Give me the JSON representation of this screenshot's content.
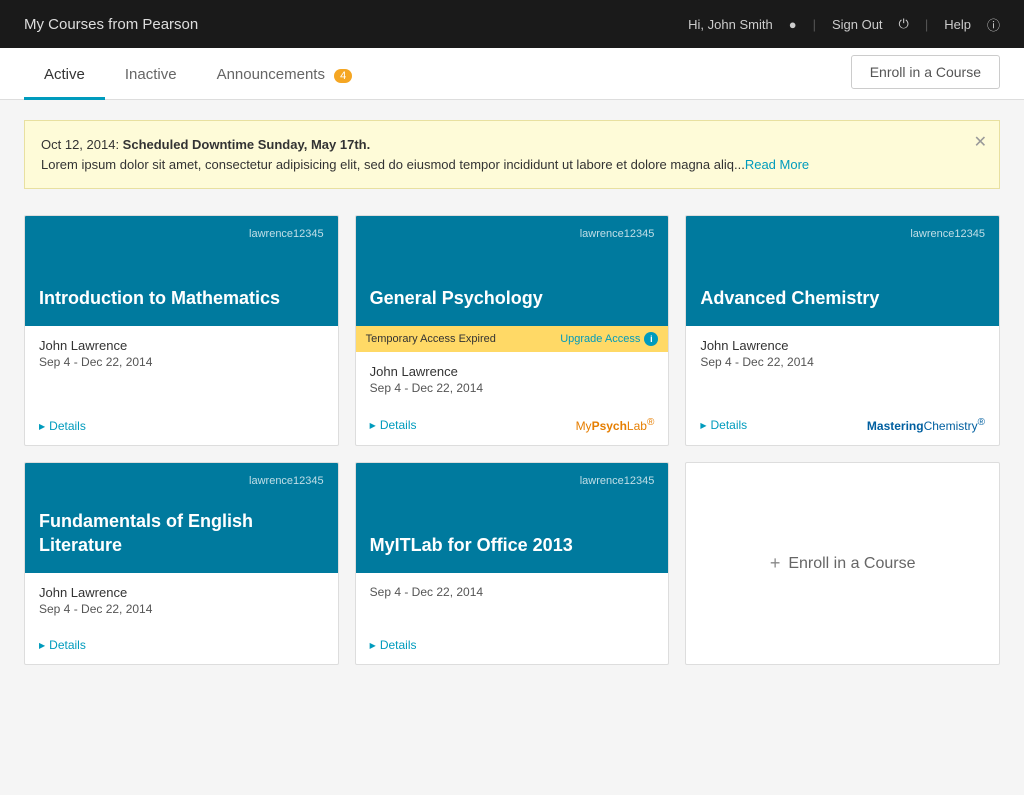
{
  "header": {
    "title": "My Courses from Pearson",
    "user": "Hi, John Smith",
    "signout": "Sign Out",
    "help": "Help"
  },
  "tabs": {
    "active_label": "Active",
    "inactive_label": "Inactive",
    "announcements_label": "Announcements",
    "announcements_badge": "4",
    "enroll_button": "Enroll in a Course"
  },
  "announcement": {
    "date": "Oct 12, 2014: ",
    "bold_text": "Scheduled Downtime Sunday, May 17th.",
    "body": "Lorem ipsum dolor sit amet, consectetur adipisicing elit, sed do eiusmod tempor incididunt ut labore et dolore magna aliq...",
    "read_more": "Read More"
  },
  "courses": [
    {
      "username": "lawrence12345",
      "title": "Introduction to Mathematics",
      "instructor": "John Lawrence",
      "dates": "Sep 4 - Dec 22, 2014",
      "details": "Details",
      "brand": null,
      "temp_access": false
    },
    {
      "username": "lawrence12345",
      "title": "General Psychology",
      "instructor": "John Lawrence",
      "dates": "Sep 4 - Dec 22, 2014",
      "details": "Details",
      "brand": "MyPsychLab",
      "temp_access": true,
      "temp_access_label": "Temporary Access Expired",
      "upgrade_label": "Upgrade Access"
    },
    {
      "username": "lawrence12345",
      "title": "Advanced Chemistry",
      "instructor": "John Lawrence",
      "dates": "Sep 4 - Dec 22, 2014",
      "details": "Details",
      "brand": "MasteringChemistry",
      "temp_access": false
    },
    {
      "username": "lawrence12345",
      "title": "Fundamentals of English Literature",
      "instructor": "John Lawrence",
      "dates": "Sep 4 - Dec 22, 2014",
      "details": "Details",
      "brand": null,
      "temp_access": false
    },
    {
      "username": "lawrence12345",
      "title": "MyITLab for Office 2013",
      "instructor": null,
      "dates": "Sep 4 - Dec 22, 2014",
      "details": "Details",
      "brand": null,
      "temp_access": false
    }
  ],
  "enroll_card": {
    "label": "Enroll in a Course"
  }
}
